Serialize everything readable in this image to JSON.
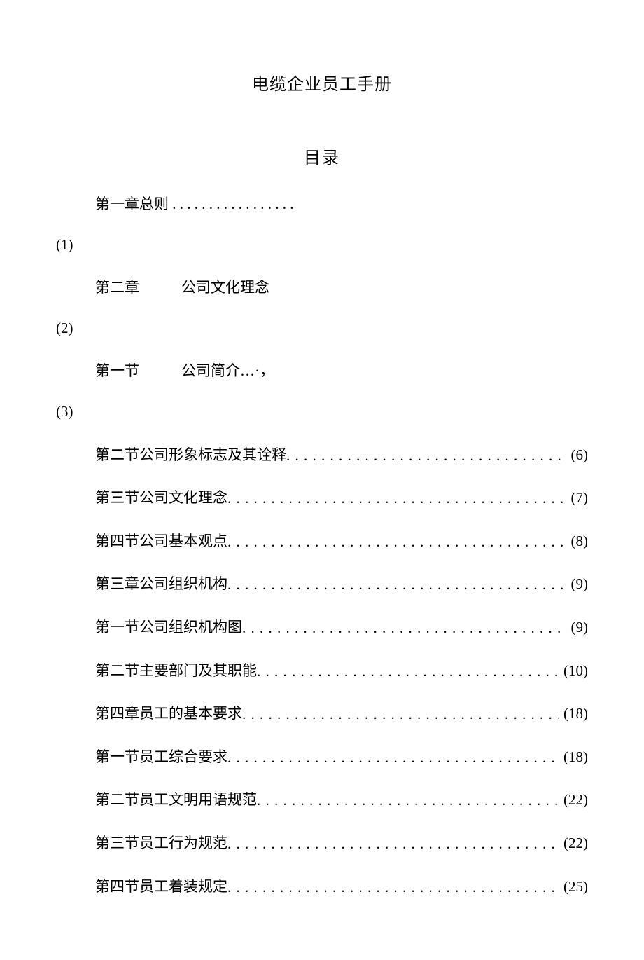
{
  "document": {
    "title": "电缆企业员工手册",
    "toc_heading": "目录",
    "head_items": [
      {
        "label": "第一章总则",
        "suffix": " . . . . . . . . . . . . . . . . .",
        "number": "(1)"
      },
      {
        "label_part1": "第二章",
        "label_part2": "公司文化理念",
        "number": "(2)"
      },
      {
        "label_part1": "第一节",
        "label_part2": "公司简介…·，",
        "number": "(3)"
      }
    ],
    "toc_entries": [
      {
        "label": "第二节公司形象标志及其诠释",
        "page": "(6)"
      },
      {
        "label": "第三节公司文化理念",
        "page": "(7)"
      },
      {
        "label": "第四节公司基本观点",
        "page": "(8)"
      },
      {
        "label": "第三章公司组织机构",
        "page": "(9)"
      },
      {
        "label": "第一节公司组织机构图",
        "page": "(9)"
      },
      {
        "label": "第二节主要部门及其职能",
        "page": "(10)"
      },
      {
        "label": "第四章员工的基本要求",
        "page": "(18)"
      },
      {
        "label": "第一节员工综合要求",
        "page": "(18)"
      },
      {
        "label": "第二节员工文明用语规范",
        "page": "(22)"
      },
      {
        "label": "第三节员工行为规范",
        "page": "(22)"
      },
      {
        "label": "第四节员工着装规定",
        "page": "(25)"
      }
    ]
  }
}
